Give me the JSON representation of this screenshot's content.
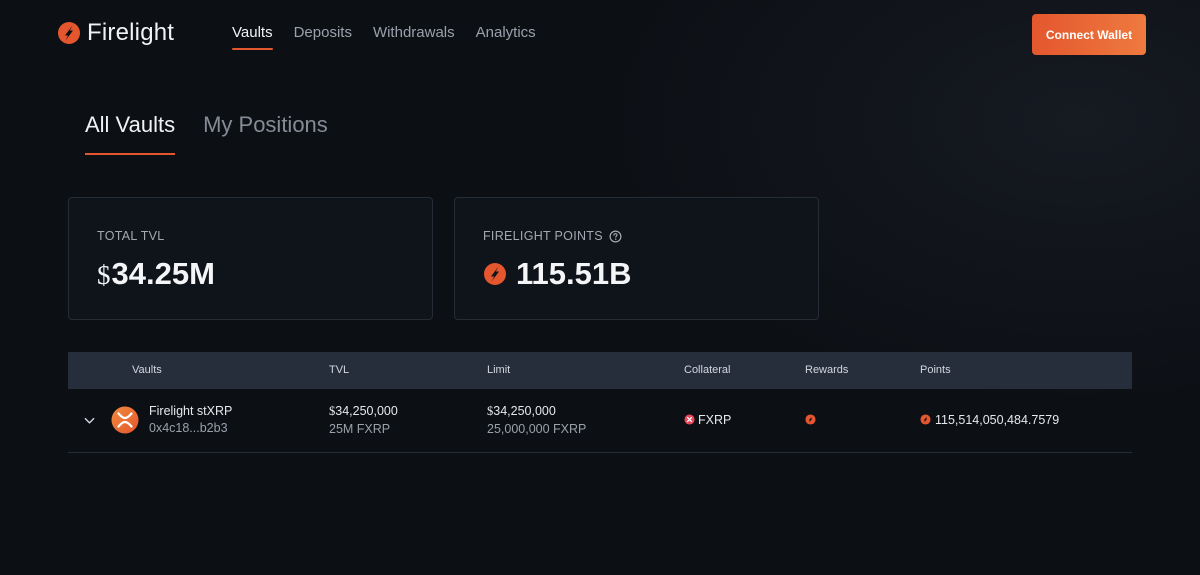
{
  "header": {
    "logo_text": "Firelight",
    "nav": [
      "Vaults",
      "Deposits",
      "Withdrawals",
      "Analytics"
    ],
    "active_nav": "Vaults",
    "connect_label": "Connect Wallet"
  },
  "tabs": {
    "items": [
      "All Vaults",
      "My Positions"
    ],
    "active": "All Vaults"
  },
  "stats": {
    "tvl": {
      "label": "TOTAL TVL",
      "currency": "$",
      "value": "34.25M"
    },
    "points": {
      "label": "FIRELIGHT POINTS",
      "value": "115.51B"
    }
  },
  "table": {
    "columns": [
      "Vaults",
      "TVL",
      "Limit",
      "Collateral",
      "Rewards",
      "Points"
    ],
    "rows": [
      {
        "name": "Firelight stXRP",
        "address": "0x4c18...b2b3",
        "tvl_currency": "$",
        "tvl": "34,250,000",
        "tvl_sub": "25M FXRP",
        "limit_currency": "$",
        "limit": "34,250,000",
        "limit_sub": "25,000,000 FXRP",
        "collateral": "FXRP",
        "points": "115,514,050,484.7579"
      }
    ]
  },
  "colors": {
    "accent": "#e4572e",
    "accent_end": "#ee7a3f",
    "bg": "#0c0f14",
    "table_header": "#262e3c"
  },
  "icons": [
    "flame-logo-icon",
    "help-icon",
    "chevron-down-icon",
    "xrp-token-icon",
    "fxrp-icon",
    "flame-icon"
  ]
}
